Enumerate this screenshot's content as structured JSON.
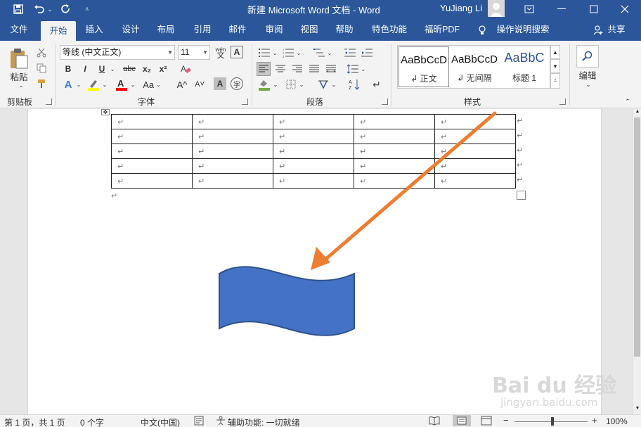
{
  "window": {
    "title": "新建 Microsoft Word 文档  -  Word",
    "user": "YuJiang Li"
  },
  "tabs": [
    "文件",
    "开始",
    "插入",
    "设计",
    "布局",
    "引用",
    "邮件",
    "审阅",
    "视图",
    "帮助",
    "特色功能",
    "福昕PDF"
  ],
  "active_tab": "开始",
  "tell_me": "操作说明搜索",
  "share": "共享",
  "clipboard": {
    "paste": "粘贴",
    "group": "剪贴板"
  },
  "font": {
    "name": "等线 (中文正文)",
    "size": "11",
    "group": "字体",
    "bold": "B",
    "italic": "I",
    "underline": "U",
    "strike": "abc",
    "sub": "x₂",
    "sup": "x²",
    "grow": "A^",
    "shrink": "A˅",
    "case": "Aa",
    "shade": "A",
    "circle": "字",
    "phonetic": "wén"
  },
  "paragraph": {
    "group": "段落"
  },
  "styles": {
    "group": "样式",
    "items": [
      {
        "preview": "AaBbCcD",
        "name": "↲ 正文",
        "color": "#111111"
      },
      {
        "preview": "AaBbCcD",
        "name": "↲ 无间隔",
        "color": "#111111"
      },
      {
        "preview": "AaBbC",
        "name": "标题 1",
        "color": "#2f5496"
      }
    ]
  },
  "editing": {
    "label": "编辑"
  },
  "document": {
    "table_rows": [
      [
        "↵",
        "↵",
        "↵",
        "↵",
        "↵"
      ],
      [
        "↵",
        "↵",
        "↵",
        "↵",
        "↵"
      ],
      [
        "↵",
        "↵",
        "↵",
        "↵",
        "↵"
      ],
      [
        "↵",
        "↵",
        "↵",
        "↵",
        "↵"
      ],
      [
        "↵",
        "↵",
        "↵",
        "↵",
        "↵"
      ]
    ],
    "row_end_mark": "↵",
    "para_mark": "↵",
    "shape": {
      "type": "wave",
      "fill": "#4472c4",
      "stroke": "#2f528f"
    },
    "arrow_color": "#ed7d31"
  },
  "status": {
    "page": "第 1 页，共 1 页",
    "words": "0 个字",
    "lang": "中文(中国)",
    "access": "辅助功能: 一切就绪",
    "zoom": "100%"
  },
  "watermark": {
    "brand": "Bai du 经验",
    "url": "jingyan.baidu.com"
  },
  "colors": {
    "brand": "#2b579a",
    "highlight": "#ffff00",
    "font_color": "#ff0000"
  }
}
